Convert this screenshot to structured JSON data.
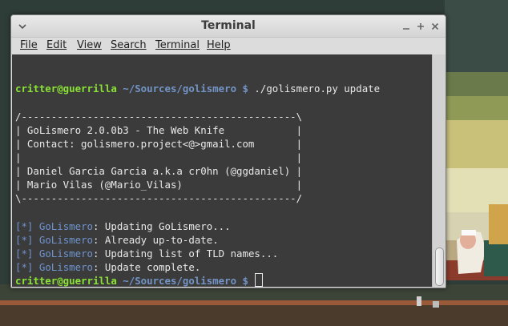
{
  "window": {
    "title": "Terminal"
  },
  "menu": [
    "File",
    "Edit",
    "View",
    "Search",
    "Terminal",
    "Help"
  ],
  "terminal": {
    "prompt_user": "critter@guerrilla",
    "prompt_path": " ~/Sources/golismero $",
    "command": " ./golismero.py update",
    "banner": [
      "/----------------------------------------------\\",
      "| GoLismero 2.0.0b3 - The Web Knife            |",
      "| Contact: golismero.project<@>gmail.com       |",
      "|                                              |",
      "| Daniel Garcia Garcia a.k.a cr0hn (@ggdaniel) |",
      "| Mario Vilas (@Mario_Vilas)                   |",
      "\\----------------------------------------------/"
    ],
    "log_tag": "[*]",
    "log_name": "GoLismero",
    "log_messages": [
      ": Updating GoLismero...",
      ": Already up-to-date.",
      ": Updating list of TLD names...",
      ": Update complete."
    ],
    "final_prompt_user": "critter@guerrilla",
    "final_prompt_path": " ~/Sources/golismero $"
  },
  "colors": {
    "prompt_user": "#8ae234",
    "prompt_path": "#7394c7",
    "background": "#3b3b3b"
  }
}
